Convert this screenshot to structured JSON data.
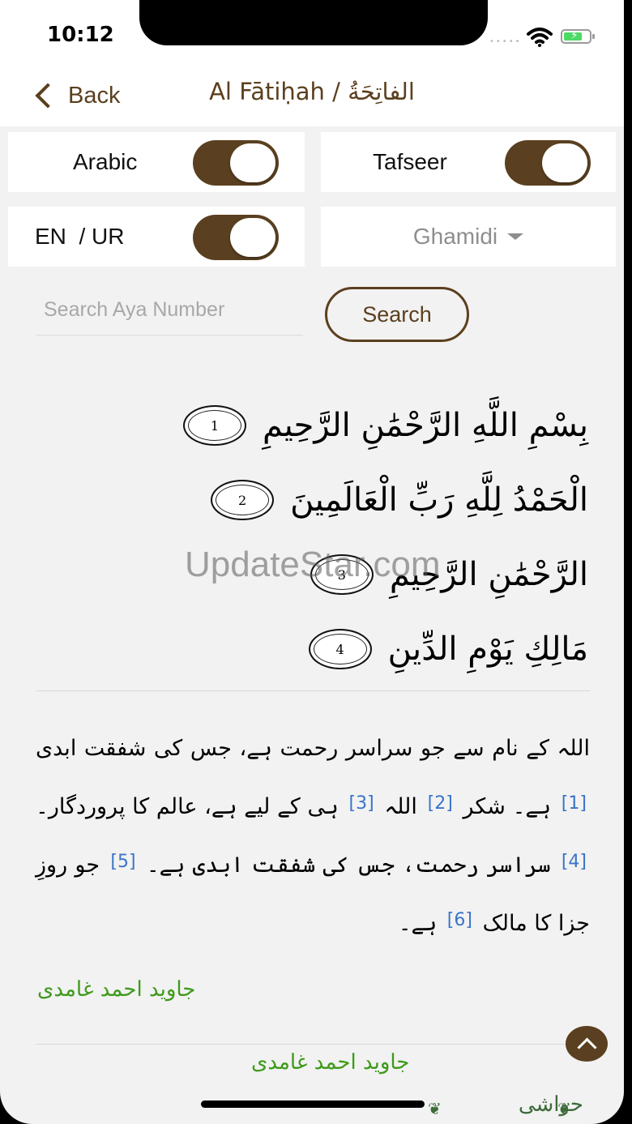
{
  "status": {
    "time": "10:12",
    "signal_dots": "•••••"
  },
  "nav": {
    "back_label": "Back",
    "title": "Al Fātiḥah / الفاتِحَةُ"
  },
  "settings": {
    "arabic_label": "Arabic",
    "arabic_on": true,
    "tafseer_label": "Tafseer",
    "tafseer_on": true,
    "lang_label": "EN  / UR",
    "lang_on": true,
    "translator_selected": "Ghamidi"
  },
  "search": {
    "placeholder": "Search Aya Number",
    "button_label": "Search"
  },
  "ayat": [
    {
      "text": "بِسْمِ اللَّهِ الرَّحْمَٰنِ الرَّحِيمِ",
      "number": "1"
    },
    {
      "text": "الْحَمْدُ لِلَّهِ رَبِّ الْعَالَمِينَ",
      "number": "2"
    },
    {
      "text": "الرَّحْمَٰنِ الرَّحِيمِ",
      "number": "3"
    },
    {
      "text": "مَالِكِ يَوْمِ الدِّينِ",
      "number": "4"
    }
  ],
  "watermark": "UpdateStar.com",
  "translation": {
    "p1": "اللہ کے نام سے جو سراسر رحمت ہے، جس کی شفقت ابدی",
    "ref1": "[1]",
    "p2": "ہے۔ شکر",
    "ref2": "[2]",
    "p3": "اللہ",
    "ref3": "[3]",
    "p4": "ہی کے لیے ہے، عالم کا پروردگار۔",
    "ref4": "[4]",
    "p5": "سراسر رحمت، جس کی شفقت ابدی ہے۔",
    "ref5": "[5]",
    "p6": "جو روزِ جزا کا مالک",
    "ref6": "[6]",
    "p7": "ہے۔"
  },
  "author_name": "جاوید احمد غامدی",
  "footer_author": "جاوید احمد غامدی",
  "hawashi": "حواشی"
}
